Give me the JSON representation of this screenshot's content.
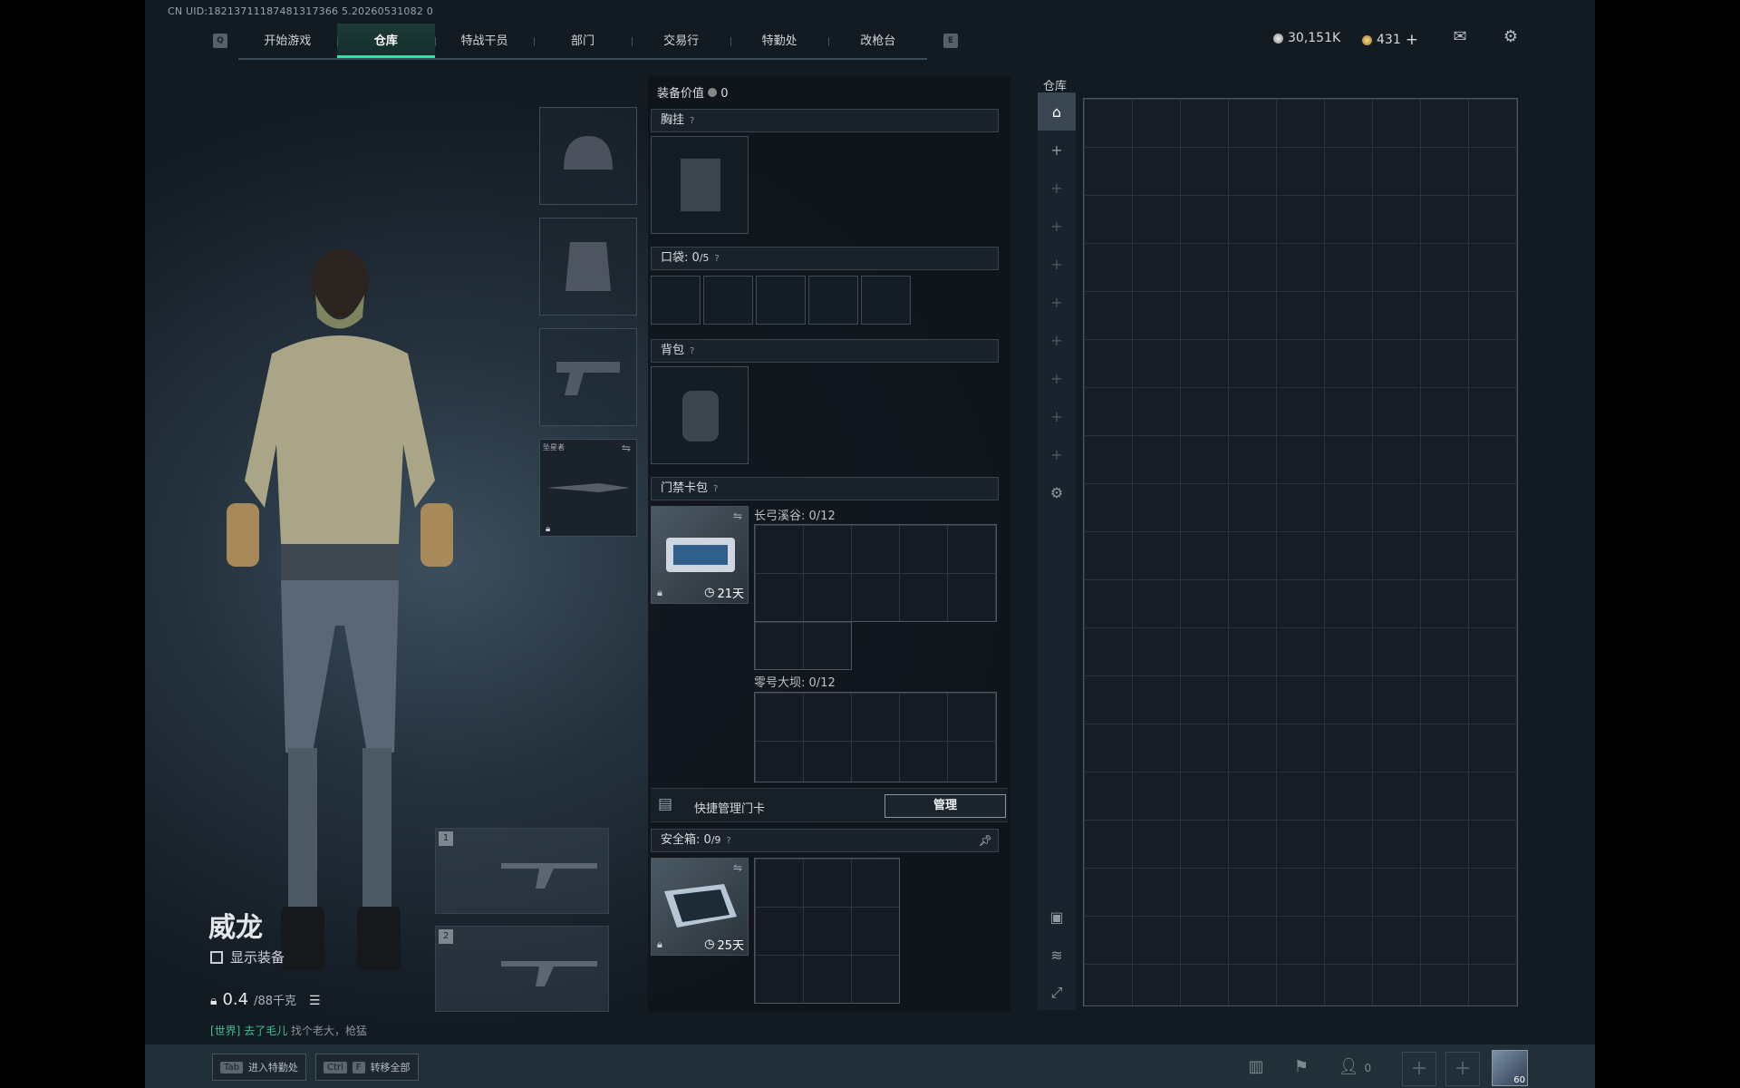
{
  "uid": "CN UID:18213711187481317366 5.20260531082 0",
  "nav": {
    "left_key": "Q",
    "right_key": "E",
    "tabs": [
      "开始游戏",
      "仓库",
      "特战干员",
      "部门",
      "交易行",
      "特勤处",
      "改枪台"
    ],
    "active_index": 1
  },
  "currency": {
    "silver": "30,151K",
    "gold": "431",
    "plus": "+"
  },
  "character": {
    "name": "威龙",
    "show_equipment": "显示装备",
    "weight": "0.4",
    "weight_max": "/88千克",
    "chat_tag": "[世界]",
    "chat_user": "去了毛儿",
    "chat_text": "找个老大，枪猛"
  },
  "gear_slots": {
    "melee_label": "坠星者",
    "weapon_1": "1",
    "weapon_2": "2"
  },
  "loadout": {
    "value_label": "装备价值",
    "value": "0",
    "vest": "胸挂",
    "pockets": "口袋",
    "pockets_count": "0",
    "pockets_max": "/5",
    "backpack": "背包",
    "keycard": "门禁卡包",
    "key1_name": "长弓溪谷",
    "key1_count": "0/12",
    "key1_days": "21天",
    "key2_name": "零号大坝",
    "key2_count": "0/12",
    "quick_manage": "快捷管理门卡",
    "manage_btn": "管理",
    "safebox": "安全箱",
    "safebox_count": "0",
    "safebox_max": "/9",
    "safebox_days": "25天",
    "help": "?"
  },
  "vault": {
    "title": "仓库"
  },
  "bottom": {
    "tab_key": "Tab",
    "tab_label": "进入特勤处",
    "ctrl_key": "Ctrl",
    "f_key": "F",
    "move_label": "转移全部",
    "friends": "0",
    "level": "60"
  },
  "colors": {
    "accent": "#35e0a2",
    "panel": "#10161c"
  }
}
